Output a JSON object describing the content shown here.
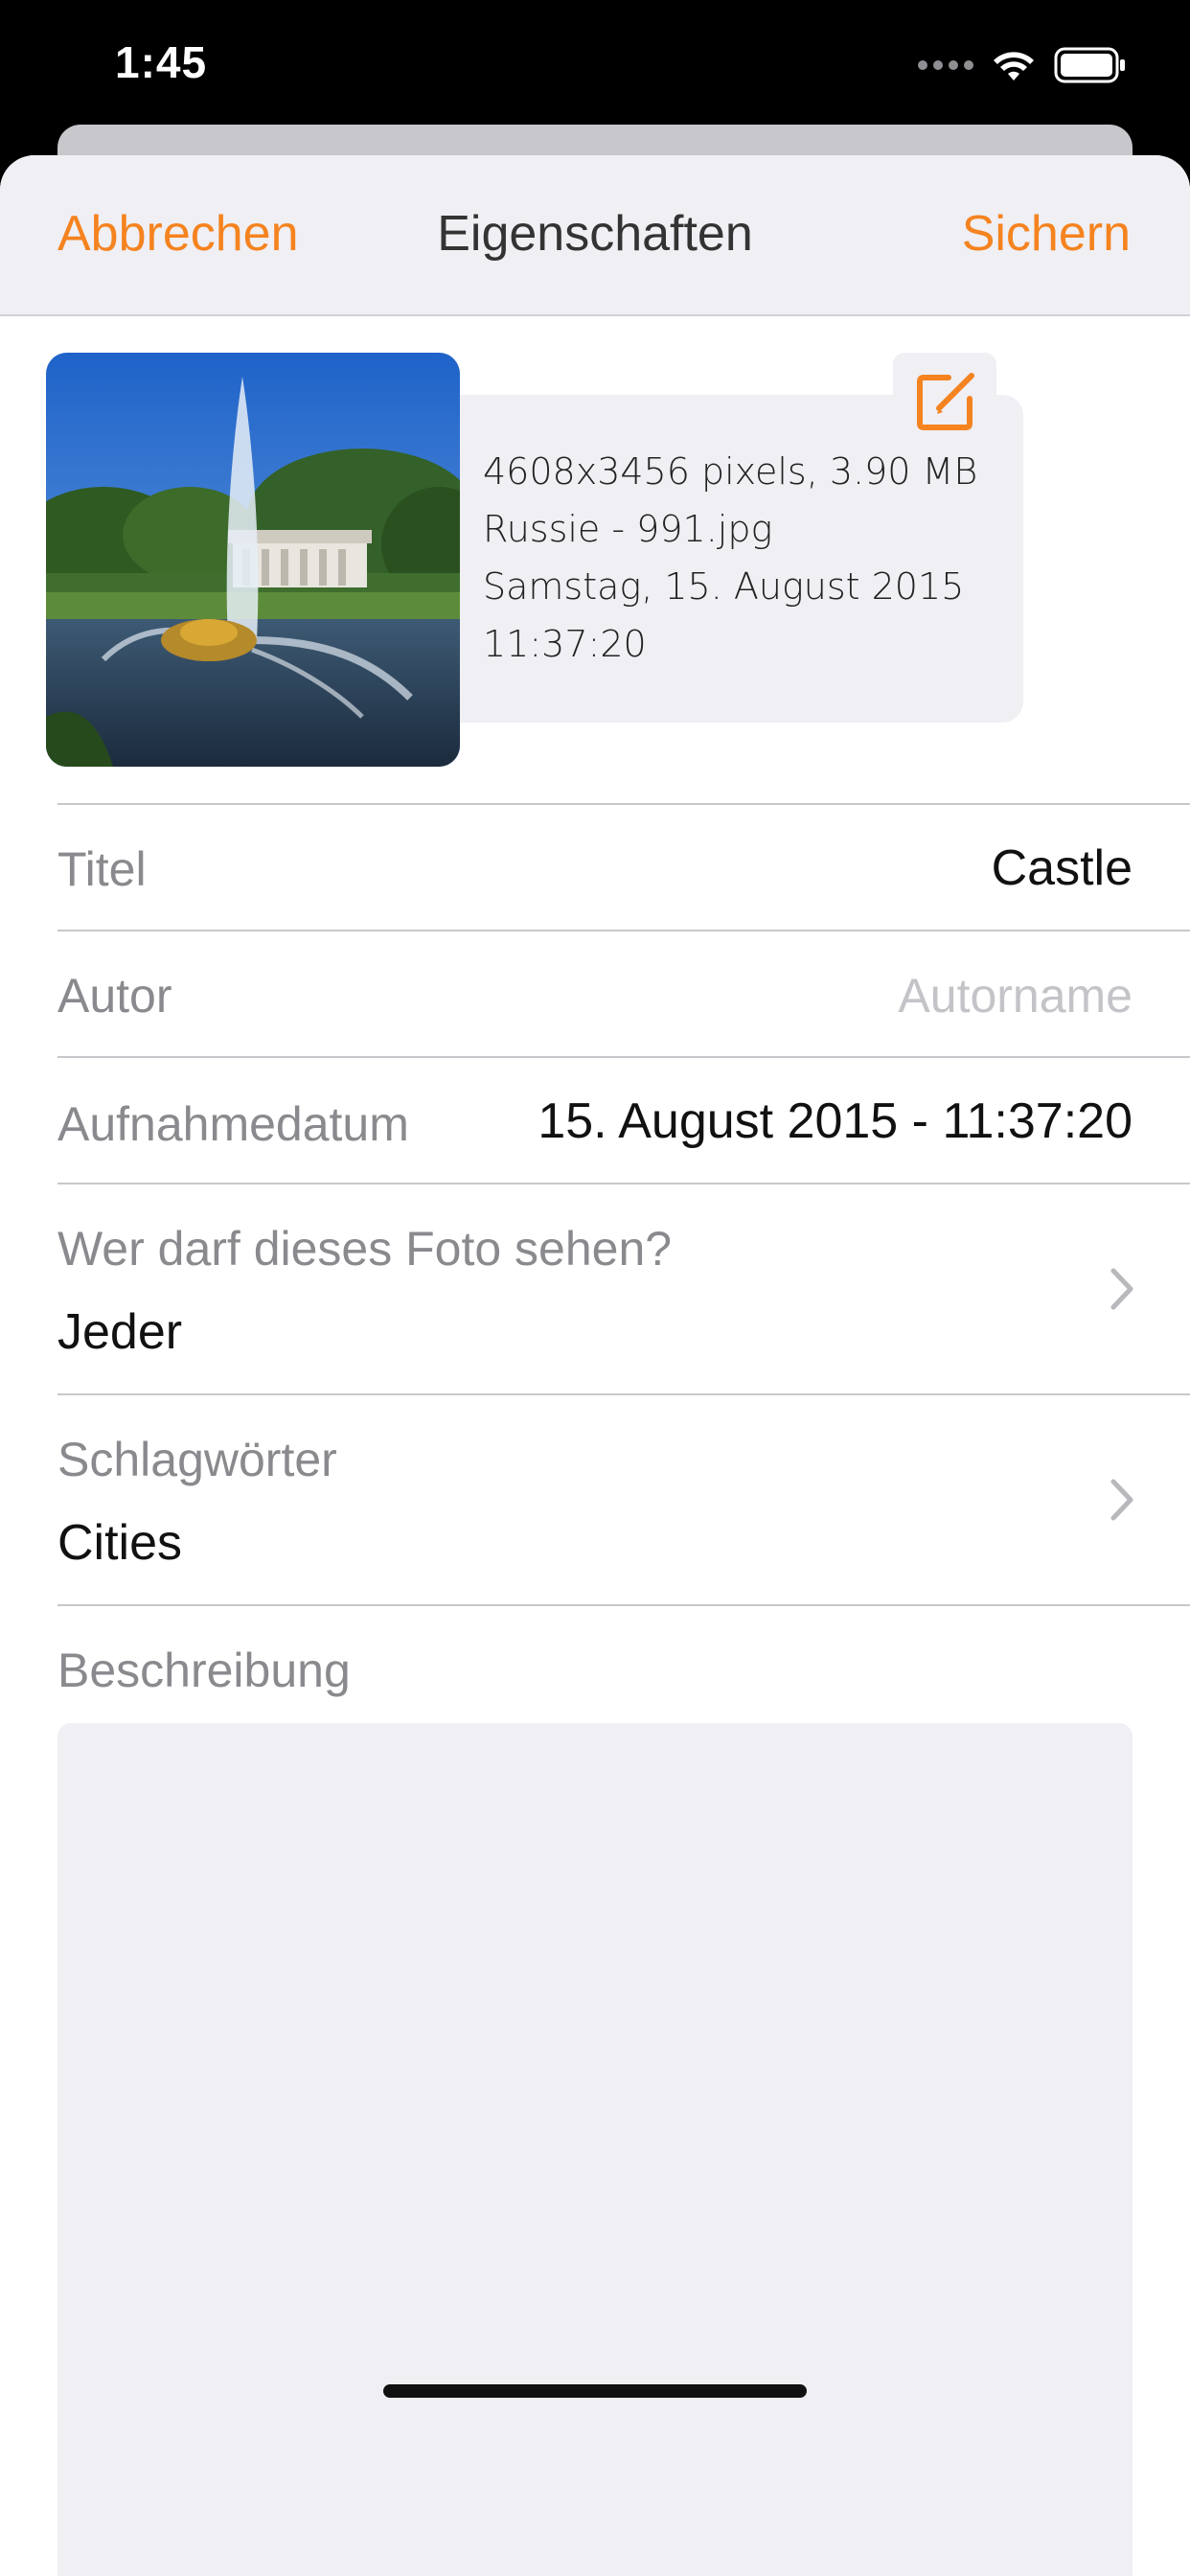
{
  "status_bar": {
    "time": "1:45"
  },
  "nav": {
    "cancel_label": "Abbrechen",
    "title": "Eigenschaften",
    "save_label": "Sichern"
  },
  "photo_info": {
    "dimensions_size": "4608x3456 pixels, 3.90 MB",
    "filename": "Russie - 991.jpg",
    "date": "Samstag, 15. August 2015",
    "time": "11:37:20"
  },
  "fields": {
    "title": {
      "label": "Titel",
      "value": "Castle"
    },
    "author": {
      "label": "Autor",
      "placeholder": "Autorname"
    },
    "capture_date": {
      "label": "Aufnahmedatum",
      "value": "15. August 2015 - 11:37:20"
    },
    "visibility": {
      "label": "Wer darf dieses Foto sehen?",
      "value": "Jeder"
    },
    "keywords": {
      "label": "Schlagwörter",
      "value": "Cities"
    },
    "description": {
      "label": "Beschreibung",
      "value": ""
    }
  },
  "colors": {
    "accent": "#f5831f",
    "sheet_header_bg": "#efeff4",
    "label_gray": "#8a8a8e",
    "placeholder_gray": "#c4c4c8"
  },
  "icons": [
    "wifi-icon",
    "battery-icon",
    "edit-icon",
    "chevron-right-icon"
  ]
}
